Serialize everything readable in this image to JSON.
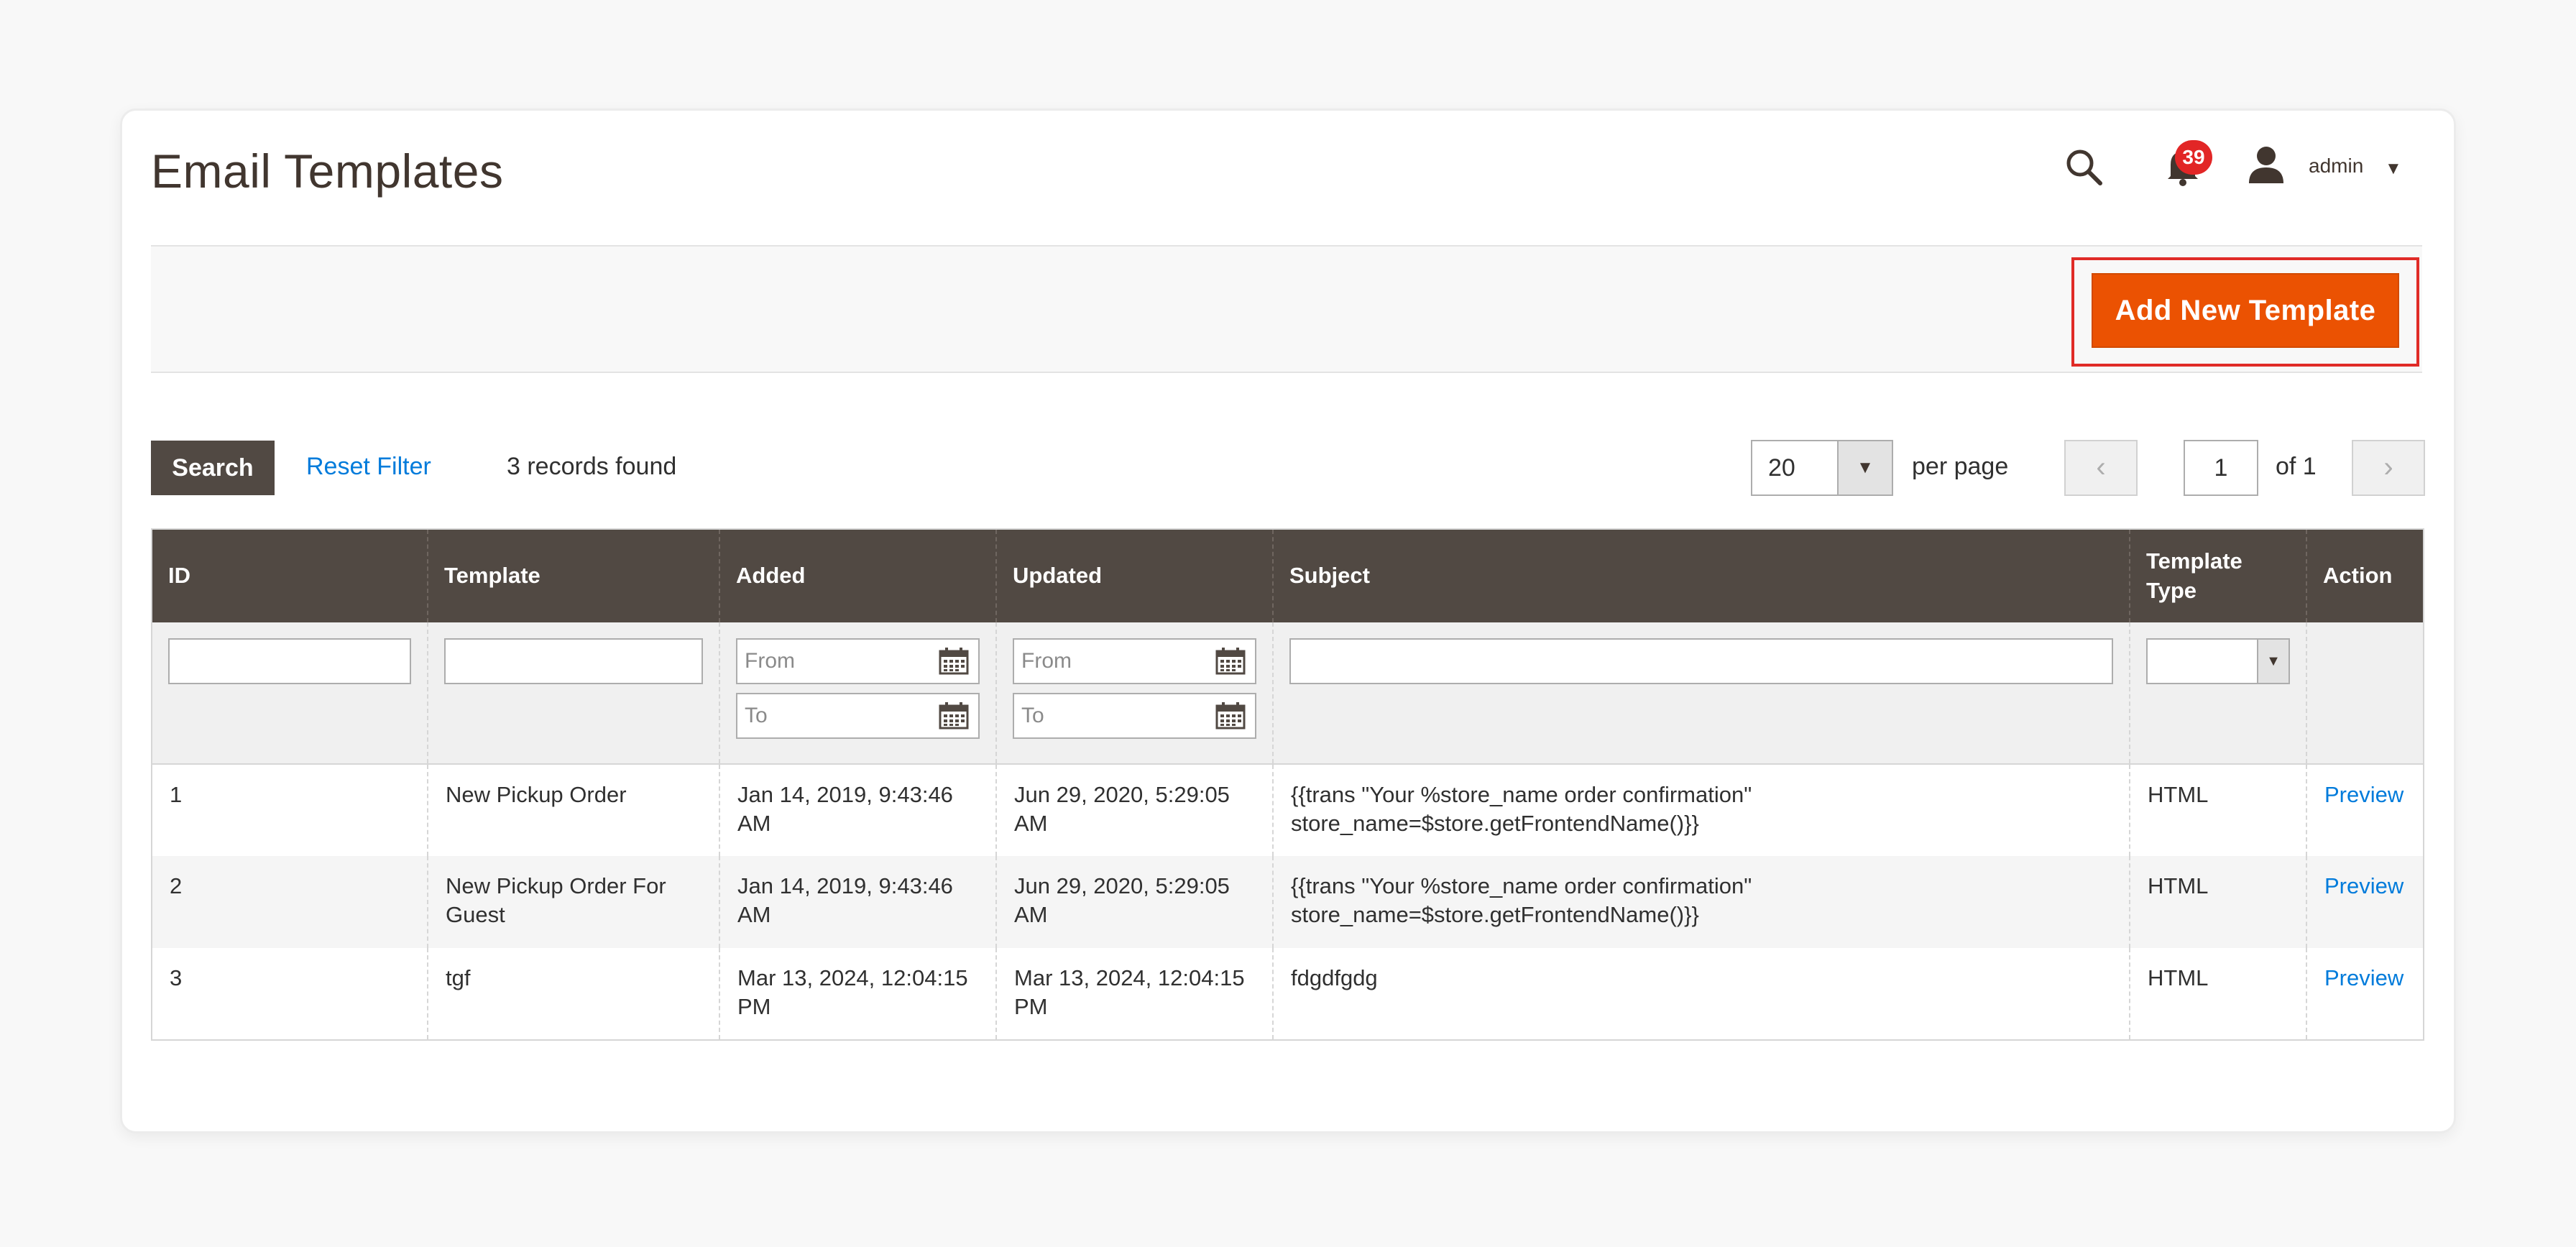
{
  "page": {
    "title": "Email Templates"
  },
  "header": {
    "notifications_count": "39",
    "user_name": "admin"
  },
  "toolbar": {
    "add_label": "Add New Template"
  },
  "grid_controls": {
    "search_label": "Search",
    "reset_label": "Reset Filter",
    "records_found": "3 records found",
    "per_page_value": "20",
    "per_page_label": "per page",
    "current_page": "1",
    "of_pages": "of 1",
    "prev_symbol": "‹",
    "next_symbol": "›"
  },
  "table": {
    "columns": [
      "ID",
      "Template",
      "Added",
      "Updated",
      "Subject",
      "Template Type",
      "Action"
    ],
    "filters": {
      "from_placeholder": "From",
      "to_placeholder": "To"
    },
    "rows": [
      {
        "id": "1",
        "template": "New Pickup Order",
        "added": "Jan 14, 2019, 9:43:46 AM",
        "updated": "Jun 29, 2020, 5:29:05 AM",
        "subject": "{{trans \"Your %store_name order confirmation\" store_name=$store.getFrontendName()}}",
        "type": "HTML",
        "action": "Preview"
      },
      {
        "id": "2",
        "template": "New Pickup Order For Guest",
        "added": "Jan 14, 2019, 9:43:46 AM",
        "updated": "Jun 29, 2020, 5:29:05 AM",
        "subject": "{{trans \"Your %store_name order confirmation\" store_name=$store.getFrontendName()}}",
        "type": "HTML",
        "action": "Preview"
      },
      {
        "id": "3",
        "template": "tgf",
        "added": "Mar 13, 2024, 12:04:15 PM",
        "updated": "Mar 13, 2024, 12:04:15 PM",
        "subject": "fdgdfgdg",
        "type": "HTML",
        "action": "Preview"
      }
    ]
  },
  "icons": {
    "search": "search-icon",
    "bell": "bell-icon",
    "user": "user-icon",
    "calendar": "calendar-icon",
    "caret": "chevron-down-icon"
  },
  "colors": {
    "accent": "#eb5202",
    "header_bg": "#514943",
    "link": "#007bdb",
    "badge": "#e22626",
    "highlight": "#e02b27"
  }
}
